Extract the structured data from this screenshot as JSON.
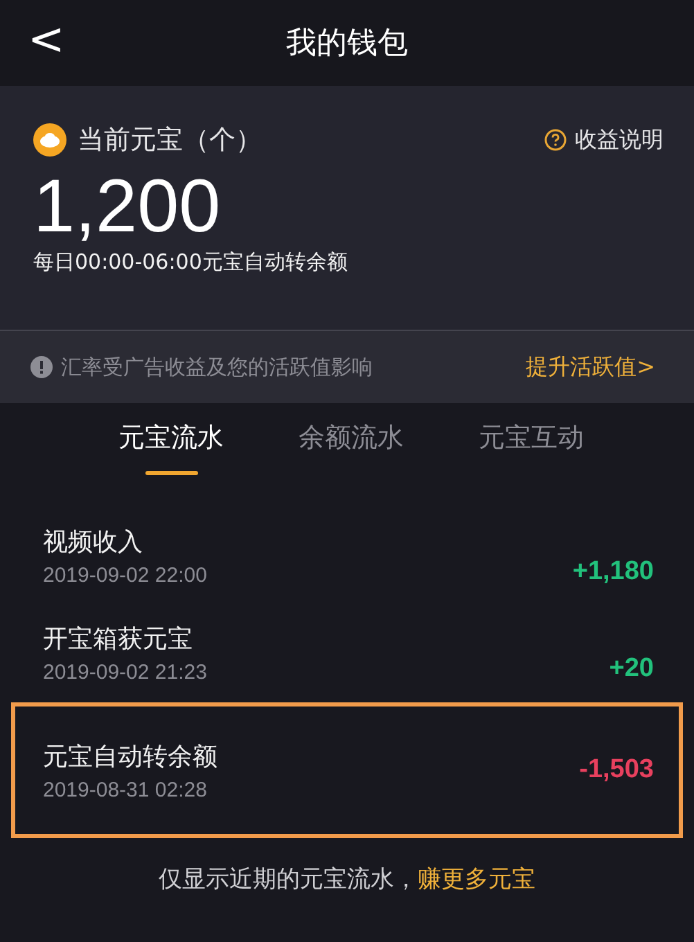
{
  "header": {
    "back_glyph": "<",
    "title": "我的钱包"
  },
  "balance": {
    "label": "当前元宝（个）",
    "help": "收益说明",
    "amount": "1,200",
    "note": "每日00:00-06:00元宝自动转余额"
  },
  "notice": {
    "text": "汇率受广告收益及您的活跃值影响",
    "link": "提升活跃值",
    "link_glyph": ">"
  },
  "tabs": [
    {
      "label": "元宝流水",
      "selected": true
    },
    {
      "label": "余额流水",
      "selected": false
    },
    {
      "label": "元宝互动",
      "selected": false
    }
  ],
  "transactions": [
    {
      "title": "视频收入",
      "time": "2019-09-02 22:00",
      "amount": "+1,180",
      "kind": "income",
      "highlighted": false
    },
    {
      "title": "开宝箱获元宝",
      "time": "2019-09-02 21:23",
      "amount": "+20",
      "kind": "income",
      "highlighted": false
    },
    {
      "title": "元宝自动转余额",
      "time": "2019-08-31 02:28",
      "amount": "-1,503",
      "kind": "expense",
      "highlighted": true
    }
  ],
  "footer": {
    "text": "仅显示近期的元宝流水，",
    "link": "赚更多元宝"
  }
}
